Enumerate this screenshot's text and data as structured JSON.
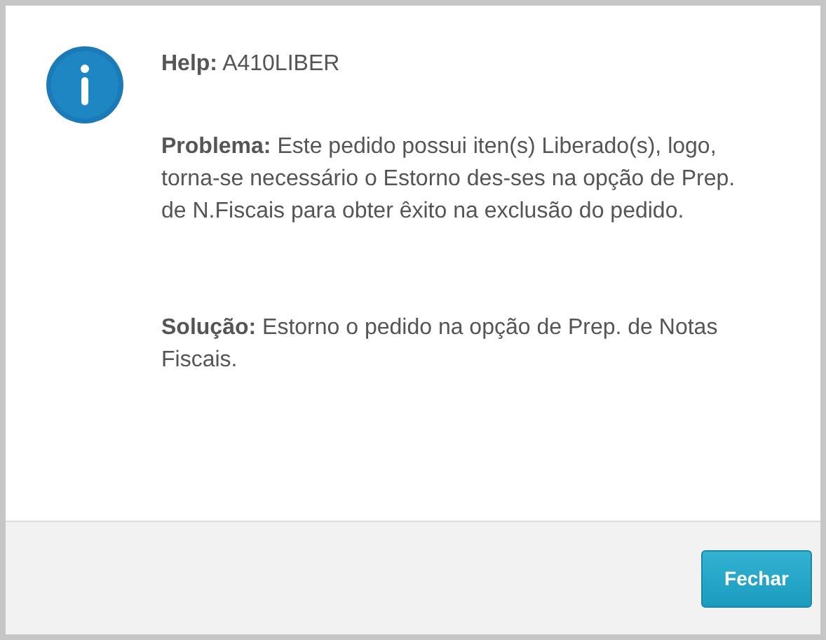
{
  "dialog": {
    "kind": "info",
    "paragraphs": [
      {
        "label": "Help:",
        "text": "A410LIBER"
      },
      {
        "label": "Problema:",
        "text": "Este pedido possui iten(s) Liberado(s), logo, torna-se necessário o Estorno des-ses na opção de Prep. de N.Fiscais para obter êxito na exclusão do pedido."
      },
      {
        "label": "Solução:",
        "text": "Estorno o pedido na opção de Prep. de Notas Fiscais."
      }
    ],
    "buttons": [
      {
        "label": "Fechar"
      }
    ]
  }
}
